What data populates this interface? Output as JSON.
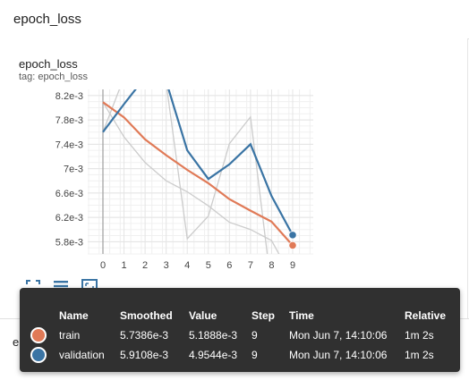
{
  "section": {
    "title": "epoch_loss"
  },
  "card": {
    "title": "epoch_loss",
    "tag": "tag: epoch_loss"
  },
  "next_card": {
    "title": "e"
  },
  "colors": {
    "train": "#e07a57",
    "validation": "#3a74a4",
    "raw_line": "#cccccc",
    "grid": "#e4e4e4"
  },
  "toolbar": {
    "icons": [
      "expand-icon",
      "data-table-icon",
      "fit-domain-icon"
    ]
  },
  "chart_data": {
    "type": "line",
    "title": "",
    "xlabel": "",
    "ylabel": "",
    "x_ticks": [
      "0",
      "1",
      "2",
      "3",
      "4",
      "5",
      "6",
      "7",
      "8",
      "9"
    ],
    "y_ticks": [
      "5.8e-3",
      "6.2e-3",
      "6.6e-3",
      "7e-3",
      "7.4e-3",
      "7.8e-3",
      "8.2e-3"
    ],
    "y_tick_values": [
      0.0058,
      0.0062,
      0.0066,
      0.007,
      0.0074,
      0.0078,
      0.0082
    ],
    "xlim": [
      0,
      9
    ],
    "ylim": [
      0.0056,
      0.0083
    ],
    "grid": true,
    "series": [
      {
        "name": "train",
        "smoothed": [
          0.00809,
          0.00784,
          0.00748,
          0.00722,
          0.00698,
          0.00676,
          0.0065,
          0.00631,
          0.00613,
          0.00574
        ],
        "raw": [
          0.00809,
          0.00752,
          0.0071,
          0.0068,
          0.00662,
          0.00639,
          0.00612,
          0.006,
          0.00582,
          0.00519
        ]
      },
      {
        "name": "validation",
        "smoothed": [
          0.0076,
          0.00806,
          0.0085,
          0.00843,
          0.0073,
          0.00683,
          0.00707,
          0.0074,
          0.00655,
          0.00591
        ],
        "raw": [
          0.0076,
          0.0085,
          0.0089,
          0.0084,
          0.00585,
          0.00622,
          0.00741,
          0.00785,
          0.00502,
          0.00495
        ]
      }
    ]
  },
  "tooltip": {
    "headers": [
      "",
      "Name",
      "Smoothed",
      "Value",
      "Step",
      "Time",
      "Relative"
    ],
    "rows": [
      {
        "name": "train",
        "smoothed": "5.7386e-3",
        "value": "5.1888e-3",
        "step": "9",
        "time": "Mon Jun 7, 14:10:06",
        "relative": "1m 2s"
      },
      {
        "name": "validation",
        "smoothed": "5.9108e-3",
        "value": "4.9544e-3",
        "step": "9",
        "time": "Mon Jun 7, 14:10:06",
        "relative": "1m 2s"
      }
    ]
  }
}
